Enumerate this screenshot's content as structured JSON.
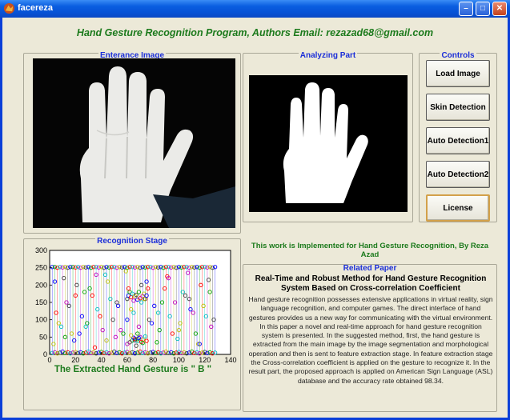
{
  "window": {
    "title": "facereza"
  },
  "heading": "Hand Gesture Recognition Program,  Authors Email: rezazad68@gmail.com",
  "panels": {
    "entrance": "Enterance Image",
    "analyzing": "Analyzing Part",
    "controls": "Controls",
    "recognition": "Recognition Stage",
    "related": "Related Paper"
  },
  "buttons": {
    "load": "Load Image",
    "skin": "Skin Detection",
    "auto1": "Auto  Detection1",
    "auto2": "Auto Detection2",
    "license": "License"
  },
  "work_note": "This work is Implemented for Hand Gesture Recognition, By Reza Azad",
  "paper": {
    "title": "Real-Time and Robust Method for Hand Gesture Recognition System Based on Cross-correlation Coefficient",
    "abstract": "Hand gesture recognition possesses extensive applications in virtual reality, sign language recognition, and computer games. The direct interface of hand gestures provides us a new way for communicating with the virtual environment. In this paper a novel and real-time approach for hand gesture recognition system is presented. In the suggested method, first, the hand gesture is extracted from the main image by the image segmentation and morphological operation and then is sent to feature extraction stage. In feature extraction stage the Cross-correlation coefficient is applied on the gesture to recognize it. In the result part, the proposed approach is applied on American Sign Language (ASL) database and the accuracy rate obtained 98.34."
  },
  "result_text": "The Extracted Hand Gesture is \" B \"",
  "colors": {
    "accent_green": "#1c7a1c",
    "legend_blue": "#1c2fd8"
  },
  "chart_data": {
    "type": "scatter",
    "title": "",
    "xlabel": "",
    "ylabel": "",
    "xlim": [
      0,
      140
    ],
    "ylim": [
      0,
      300
    ],
    "xticks": [
      0,
      20,
      40,
      60,
      80,
      100,
      120,
      140
    ],
    "yticks": [
      0,
      50,
      100,
      150,
      200,
      250,
      300
    ],
    "marker": "circle",
    "series_colors": [
      "#0000ff",
      "#00a000",
      "#ff0000",
      "#00bfbf",
      "#bf00bf",
      "#bfbf00",
      "#404040"
    ],
    "series": [
      {
        "x": [
          2,
          4,
          6,
          8,
          10,
          12,
          14,
          16,
          18,
          20,
          22,
          24,
          26,
          28,
          30,
          32,
          34,
          36,
          38,
          40,
          42,
          44,
          46,
          48,
          50,
          52,
          54,
          56,
          58,
          60,
          62,
          64,
          66,
          68,
          70,
          72,
          74,
          76,
          78,
          80,
          82,
          84,
          86,
          88,
          90,
          92,
          94,
          96,
          98,
          100,
          102,
          104,
          106,
          108,
          110,
          112,
          114,
          116,
          118,
          120,
          122,
          124,
          126,
          128
        ],
        "y": [
          252,
          252,
          250,
          252,
          251,
          252,
          250,
          252,
          252,
          251,
          252,
          250,
          252,
          251,
          252,
          250,
          252,
          252,
          251,
          252,
          250,
          252,
          251,
          252,
          252,
          250,
          252,
          251,
          252,
          250,
          252,
          252,
          251,
          252,
          250,
          252,
          251,
          252,
          252,
          250,
          252,
          251,
          252,
          250,
          252,
          252,
          251,
          252,
          250,
          252,
          251,
          252,
          252,
          250,
          252,
          251,
          252,
          250,
          252,
          252,
          251,
          252,
          250,
          252
        ]
      },
      {
        "x": [
          2,
          4,
          6,
          8,
          10,
          12,
          14,
          16,
          18,
          20,
          22,
          24,
          26,
          28,
          30,
          32,
          34,
          36,
          38,
          40,
          42,
          44,
          46,
          48,
          50,
          52,
          54,
          56,
          58,
          60,
          62,
          64,
          66,
          68,
          70,
          72,
          74,
          76,
          78,
          80,
          82,
          84,
          86,
          88,
          90,
          92,
          94,
          96,
          98,
          100,
          102,
          104,
          106,
          108,
          110,
          112,
          114,
          116,
          118,
          120,
          122,
          124,
          126,
          128
        ],
        "y": [
          4,
          6,
          3,
          5,
          8,
          4,
          6,
          3,
          5,
          7,
          4,
          6,
          3,
          5,
          8,
          4,
          6,
          3,
          5,
          7,
          4,
          6,
          3,
          5,
          8,
          4,
          6,
          3,
          5,
          7,
          4,
          6,
          3,
          5,
          8,
          4,
          6,
          3,
          5,
          7,
          4,
          6,
          3,
          5,
          8,
          4,
          6,
          3,
          5,
          7,
          4,
          6,
          3,
          5,
          8,
          4,
          6,
          3,
          5,
          7,
          4,
          6,
          3,
          5
        ]
      },
      {
        "x": [
          60,
          61,
          62,
          63,
          64,
          65,
          66,
          67,
          68,
          69,
          70,
          71,
          72,
          73,
          74,
          75,
          64,
          66,
          68,
          70,
          72,
          62,
          65,
          68,
          71,
          74,
          60,
          63,
          66,
          69,
          72,
          75
        ],
        "y": [
          160,
          170,
          180,
          165,
          175,
          155,
          168,
          172,
          158,
          180,
          162,
          150,
          168,
          175,
          160,
          170,
          40,
          45,
          38,
          50,
          42,
          35,
          48,
          44,
          36,
          52,
          30,
          55,
          41,
          47,
          33,
          39
        ]
      },
      {
        "x": [
          5,
          9,
          13,
          17,
          21,
          25,
          29,
          33,
          37,
          41,
          45,
          49,
          53,
          57,
          61,
          65,
          69,
          73,
          77,
          81,
          85,
          89,
          93,
          97,
          101,
          105,
          109,
          113,
          117,
          121,
          125,
          3,
          11,
          19,
          27,
          35,
          43,
          51,
          59,
          67,
          75,
          83,
          91,
          99,
          107,
          115,
          123
        ],
        "y": [
          120,
          80,
          150,
          60,
          200,
          110,
          90,
          170,
          130,
          70,
          210,
          100,
          140,
          60,
          190,
          120,
          80,
          160,
          100,
          140,
          70,
          190,
          110,
          150,
          90,
          170,
          130,
          60,
          200,
          110,
          80,
          30,
          220,
          40,
          180,
          20,
          230,
          50,
          240,
          25,
          210,
          35,
          225,
          45,
          235,
          30,
          215
        ]
      },
      {
        "x": [
          7,
          15,
          23,
          31,
          39,
          47,
          55,
          63,
          71,
          79,
          87,
          95,
          103,
          111,
          119,
          127,
          4,
          12,
          20,
          28,
          36,
          44,
          52,
          60,
          68,
          76,
          84,
          92,
          100,
          108,
          116,
          124
        ],
        "y": [
          90,
          140,
          60,
          190,
          110,
          160,
          70,
          130,
          200,
          90,
          150,
          60,
          180,
          120,
          140,
          100,
          210,
          50,
          170,
          80,
          230,
          40,
          150,
          100,
          60,
          190,
          120,
          220,
          70,
          160,
          30,
          180
        ]
      }
    ]
  }
}
